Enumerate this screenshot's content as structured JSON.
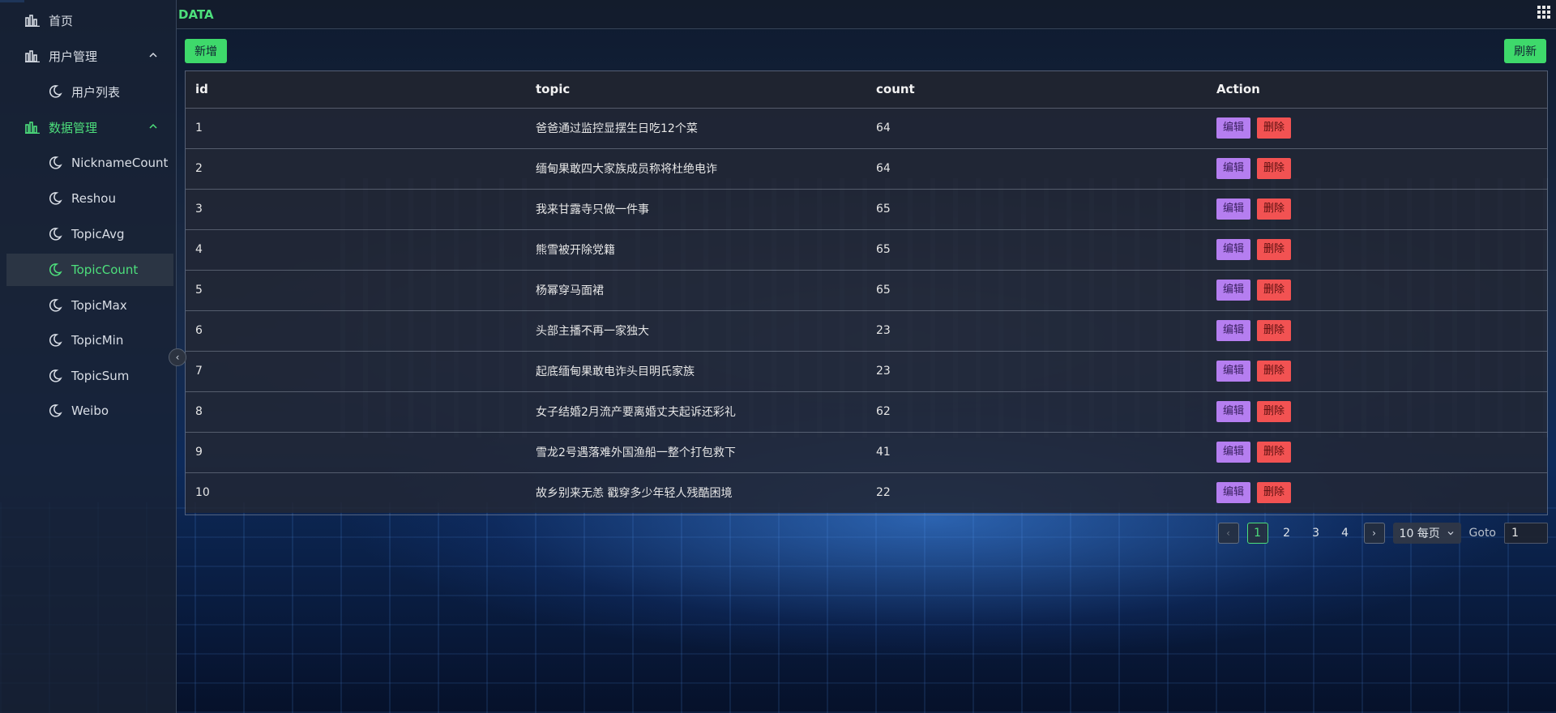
{
  "header": {
    "title": "DATA"
  },
  "sidebar": {
    "items": [
      {
        "label": "首页"
      },
      {
        "label": "用户管理"
      },
      {
        "label": "用户列表"
      },
      {
        "label": "数据管理"
      },
      {
        "label": "NicknameCount"
      },
      {
        "label": "Reshou"
      },
      {
        "label": "TopicAvg"
      },
      {
        "label": "TopicCount"
      },
      {
        "label": "TopicMax"
      },
      {
        "label": "TopicMin"
      },
      {
        "label": "TopicSum"
      },
      {
        "label": "Weibo"
      }
    ]
  },
  "toolbar": {
    "add_label": "新增",
    "refresh_label": "刷新"
  },
  "table": {
    "columns": [
      "id",
      "topic",
      "count",
      "Action"
    ],
    "rows": [
      {
        "id": "1",
        "topic": "爸爸通过监控显摆生日吃12个菜",
        "count": "64"
      },
      {
        "id": "2",
        "topic": "缅甸果敢四大家族成员称将杜绝电诈",
        "count": "64"
      },
      {
        "id": "3",
        "topic": "我来甘露寺只做一件事",
        "count": "65"
      },
      {
        "id": "4",
        "topic": "熊雪被开除党籍",
        "count": "65"
      },
      {
        "id": "5",
        "topic": "杨幂穿马面裙",
        "count": "65"
      },
      {
        "id": "6",
        "topic": "头部主播不再一家独大",
        "count": "23"
      },
      {
        "id": "7",
        "topic": "起底缅甸果敢电诈头目明氏家族",
        "count": "23"
      },
      {
        "id": "8",
        "topic": "女子结婚2月流产要离婚丈夫起诉还彩礼",
        "count": "62"
      },
      {
        "id": "9",
        "topic": "雪龙2号遇落难外国渔船一整个打包救下",
        "count": "41"
      },
      {
        "id": "10",
        "topic": "故乡别来无恙 戳穿多少年轻人残酷困境",
        "count": "22"
      }
    ],
    "edit_label": "编辑",
    "delete_label": "删除"
  },
  "pagination": {
    "pages": [
      "1",
      "2",
      "3",
      "4"
    ],
    "current": "1",
    "page_size_label": "10 每页",
    "goto_label": "Goto",
    "goto_value": "1"
  },
  "colors": {
    "accent": "#4ddf7c",
    "edit": "#b57ef0",
    "delete": "#f25252"
  }
}
